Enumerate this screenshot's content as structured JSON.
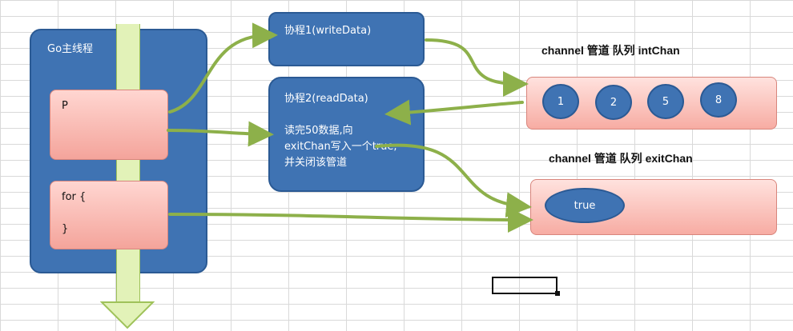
{
  "main_thread": {
    "title": "Go主线程",
    "p_label": "P",
    "for_line1": "for {",
    "for_line2": "}"
  },
  "writer": {
    "title": "协程1(writeData)"
  },
  "reader": {
    "title": "协程2(readData)",
    "desc_line1": "读完50数据,向",
    "desc_line2": "exitChan写入一个true,",
    "desc_line3": "并关闭该管道"
  },
  "int_chan": {
    "label": "channel 管道 队列 intChan",
    "items": [
      "1",
      "2",
      "5",
      "8"
    ]
  },
  "exit_chan": {
    "label": "channel 管道 队列 exitChan",
    "value": "true"
  },
  "colors": {
    "node": "#3f73b3",
    "queue": "#f7aca3",
    "arrow": "#8db04a",
    "thread_bar": "#e2f2b8"
  }
}
